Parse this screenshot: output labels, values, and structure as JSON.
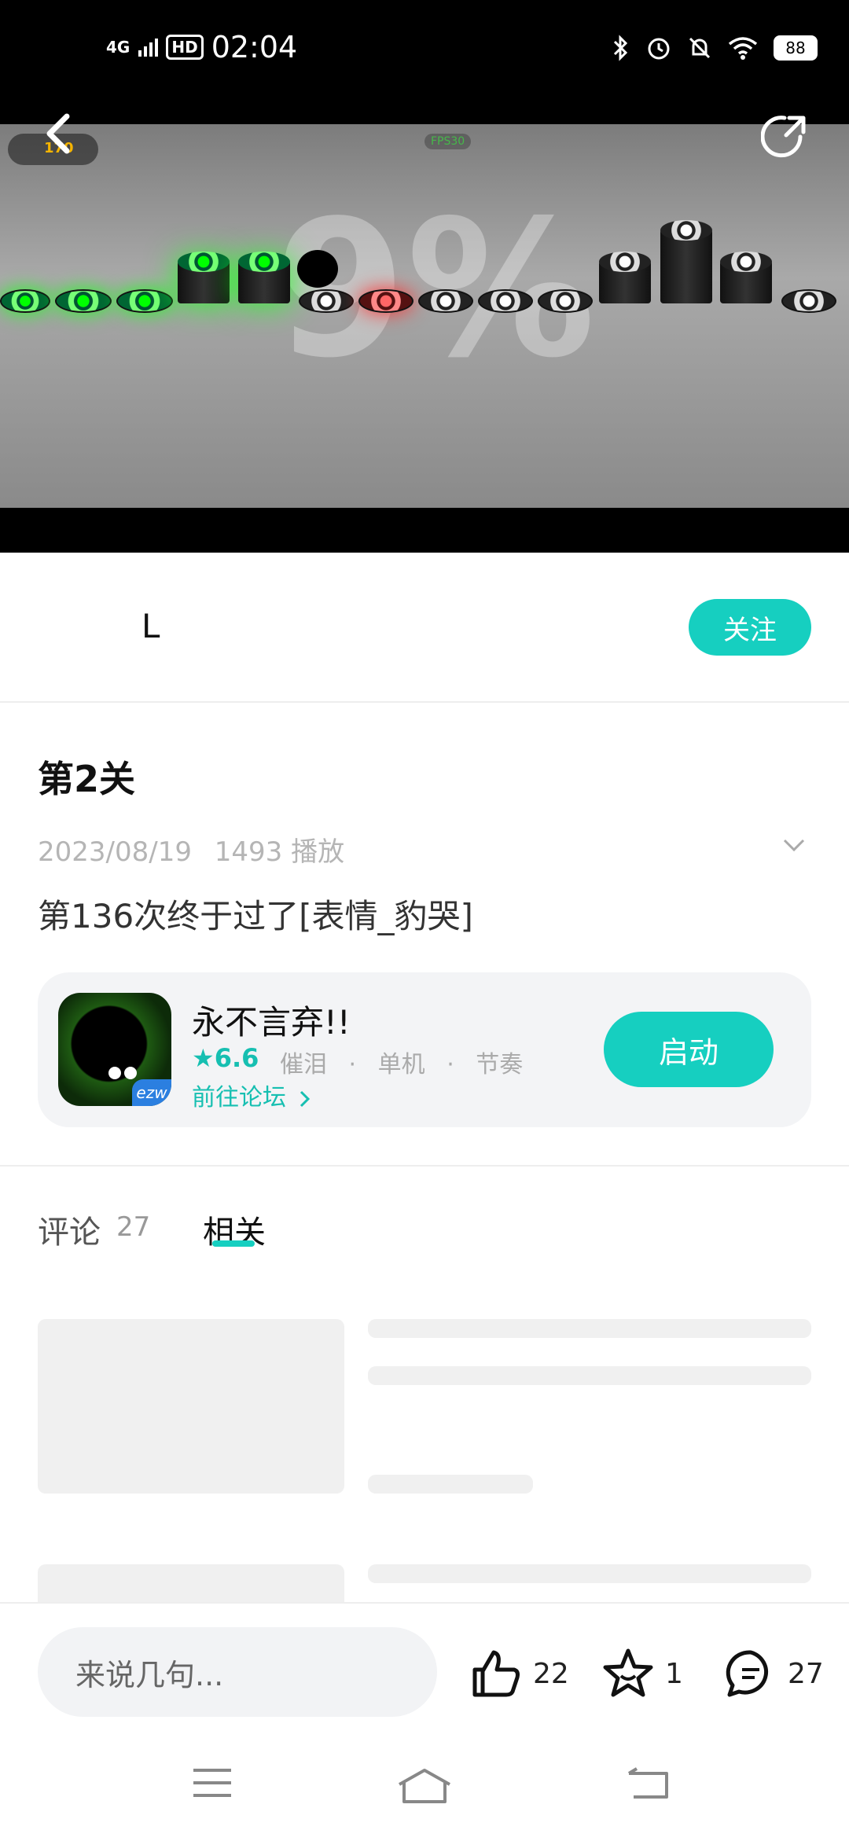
{
  "status_bar": {
    "network": "4G",
    "hd": "HD",
    "time": "02:04",
    "battery": "88"
  },
  "video": {
    "overlay_text": "9%",
    "fps_label": "FPS30",
    "coin_count": "170"
  },
  "author": {
    "name": "L",
    "follow_label": "关注"
  },
  "post": {
    "title": "第2关",
    "date": "2023/08/19",
    "plays": "1493 播放",
    "description": "第136次终于过了[表情_豹哭]"
  },
  "game_card": {
    "name": "永不言弃!!",
    "rating": "6.6",
    "tags": [
      "催泪",
      "单机",
      "节奏"
    ],
    "forum_link": "前往论坛",
    "launch_label": "启动",
    "icon_badge": "ezw"
  },
  "tabs": {
    "comments_label": "评论",
    "comments_count": "27",
    "related_label": "相关"
  },
  "bottom_bar": {
    "input_placeholder": "来说几句...",
    "likes": "22",
    "favorites": "1",
    "comments": "27"
  },
  "icons": {
    "back": "chevron-left-icon",
    "share": "share-icon",
    "expand": "chevron-down-icon",
    "like": "thumbs-up-icon",
    "favorite": "star-face-icon",
    "comment": "chat-bubble-icon"
  },
  "colors": {
    "accent": "#16cfc0"
  }
}
